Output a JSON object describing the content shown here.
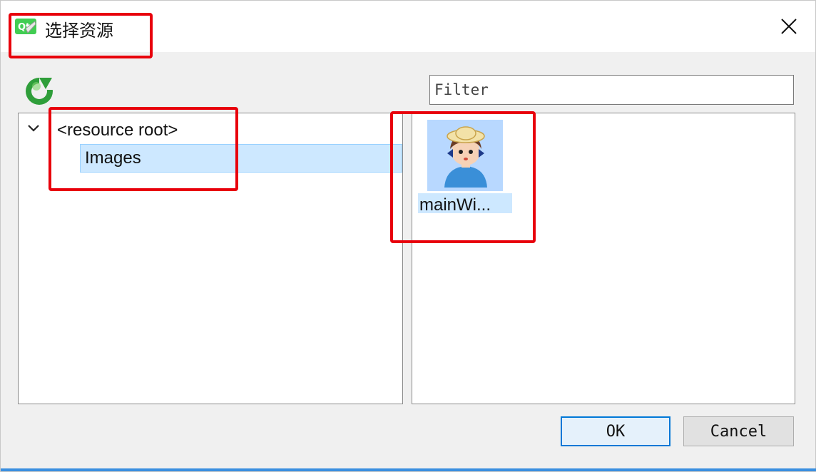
{
  "window": {
    "title": "选择资源",
    "close_glyph": "✕"
  },
  "toolbar": {
    "refresh_icon": "refresh-icon"
  },
  "filter": {
    "placeholder": "Filter",
    "value": ""
  },
  "tree": {
    "root_label": "<resource root>",
    "children": [
      {
        "label": "Images",
        "selected": true
      }
    ]
  },
  "resources": {
    "items": [
      {
        "label": "mainWi...",
        "selected": true,
        "icon": "cartoon-girl-thumbnail"
      }
    ]
  },
  "buttons": {
    "ok_label": "OK",
    "cancel_label": "Cancel"
  },
  "colors": {
    "selection": "#cde8ff",
    "annotation": "#e8000b",
    "accent": "#0078d7"
  }
}
